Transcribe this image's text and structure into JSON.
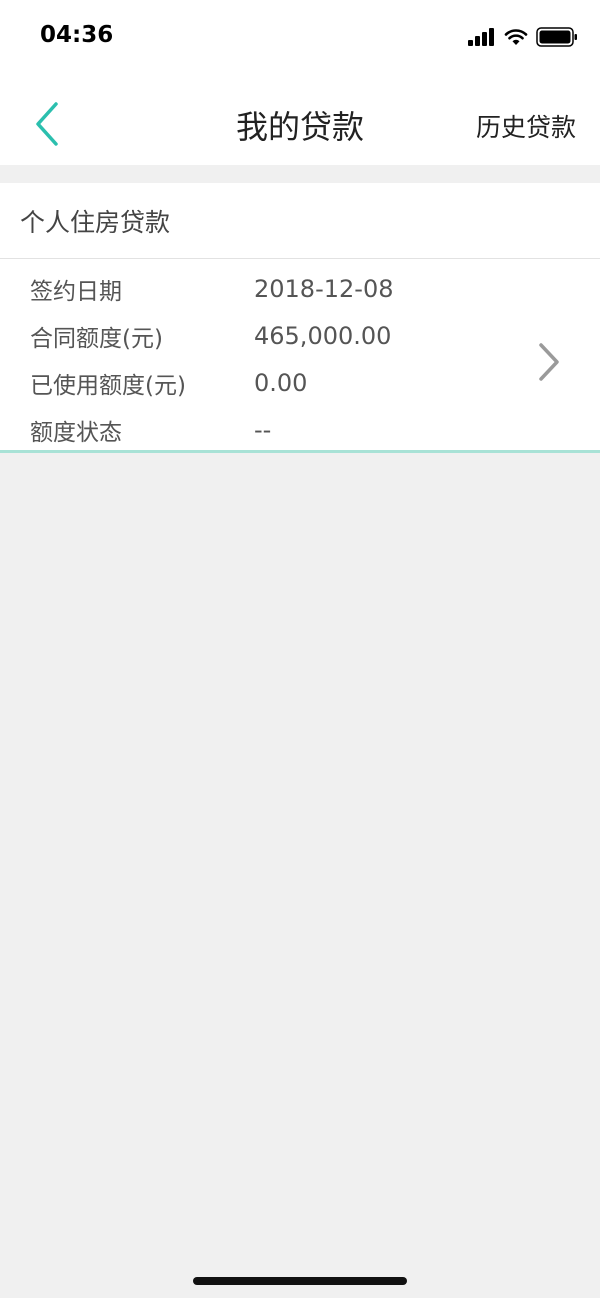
{
  "status_bar": {
    "time": "04:36",
    "icons": [
      "signal-icon",
      "wifi-icon",
      "battery-icon"
    ]
  },
  "nav": {
    "back_icon": "chevron-left-icon",
    "title": "我的贷款",
    "history_label": "历史贷款"
  },
  "loan": {
    "type": "个人住房贷款",
    "rows": [
      {
        "label": "签约日期",
        "value": "2018-12-08"
      },
      {
        "label": "合同额度(元)",
        "value": "465,000.00"
      },
      {
        "label": "已使用额度(元)",
        "value": "0.00"
      },
      {
        "label": "额度状态",
        "value": "--"
      }
    ],
    "detail_icon": "chevron-right-icon"
  },
  "colors": {
    "accent": "#2bbfae",
    "background": "#f0f0f0",
    "card": "#ffffff",
    "divider_accent": "#a8e2d6"
  }
}
